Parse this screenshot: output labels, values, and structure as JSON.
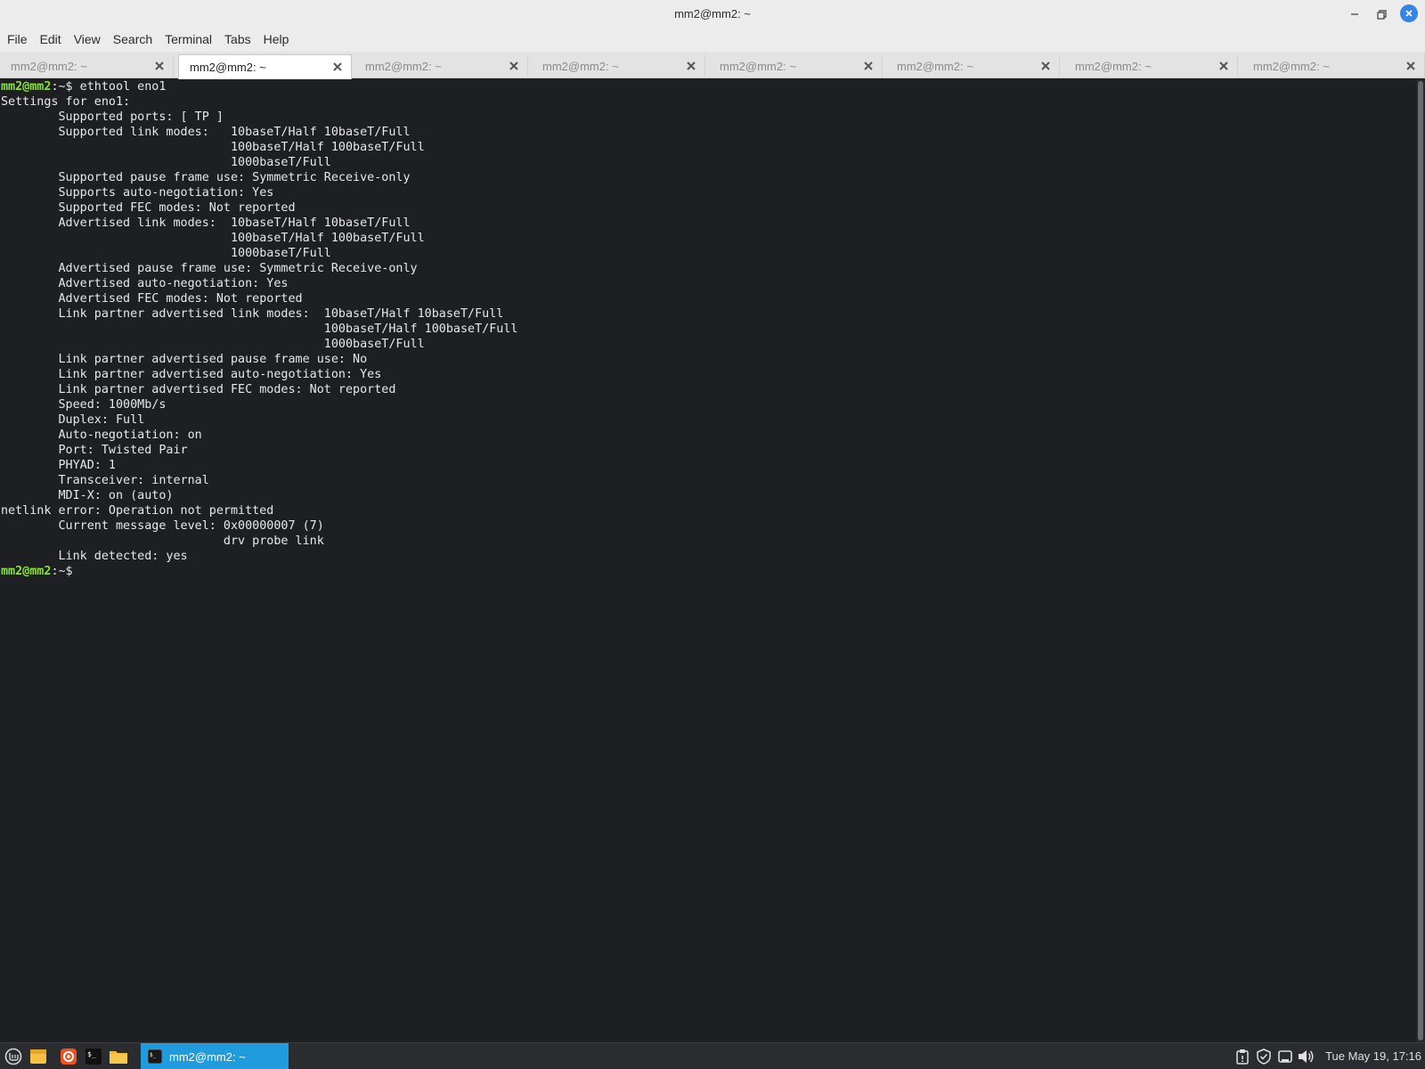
{
  "window": {
    "title": "mm2@mm2: ~"
  },
  "menu": [
    "File",
    "Edit",
    "View",
    "Search",
    "Terminal",
    "Tabs",
    "Help"
  ],
  "tabs": [
    {
      "label": "mm2@mm2: ~",
      "active": false
    },
    {
      "label": "mm2@mm2: ~",
      "active": true
    },
    {
      "label": "mm2@mm2: ~",
      "active": false
    },
    {
      "label": "mm2@mm2: ~",
      "active": false
    },
    {
      "label": "mm2@mm2: ~",
      "active": false
    },
    {
      "label": "mm2@mm2: ~",
      "active": false
    },
    {
      "label": "mm2@mm2: ~",
      "active": false
    },
    {
      "label": "mm2@mm2: ~",
      "active": false
    }
  ],
  "terminal": {
    "prompt_user": "mm2@mm2",
    "prompt_path": ":~$",
    "command": " ethtool eno1",
    "output": "Settings for eno1:\n        Supported ports: [ TP ]\n        Supported link modes:   10baseT/Half 10baseT/Full\n                                100baseT/Half 100baseT/Full\n                                1000baseT/Full\n        Supported pause frame use: Symmetric Receive-only\n        Supports auto-negotiation: Yes\n        Supported FEC modes: Not reported\n        Advertised link modes:  10baseT/Half 10baseT/Full\n                                100baseT/Half 100baseT/Full\n                                1000baseT/Full\n        Advertised pause frame use: Symmetric Receive-only\n        Advertised auto-negotiation: Yes\n        Advertised FEC modes: Not reported\n        Link partner advertised link modes:  10baseT/Half 10baseT/Full\n                                             100baseT/Half 100baseT/Full\n                                             1000baseT/Full\n        Link partner advertised pause frame use: No\n        Link partner advertised auto-negotiation: Yes\n        Link partner advertised FEC modes: Not reported\n        Speed: 1000Mb/s\n        Duplex: Full\n        Auto-negotiation: on\n        Port: Twisted Pair\n        PHYAD: 1\n        Transceiver: internal\n        MDI-X: on (auto)\nnetlink error: Operation not permitted\n        Current message level: 0x00000007 (7)\n                               drv probe link\n        Link detected: yes",
    "final_prompt_user": "mm2@mm2",
    "final_prompt_path": ":~$"
  },
  "taskbar": {
    "window_label": "mm2@mm2: ~",
    "clock": "Tue May 19, 17:16",
    "icons": [
      "mint-menu-icon",
      "files-icon",
      "browser-icon",
      "terminal-icon",
      "folder-icon"
    ],
    "tray": [
      "clipboard-icon",
      "shield-icon",
      "network-icon",
      "volume-icon"
    ]
  },
  "colors": {
    "terminal_bg": "#1e1f23",
    "prompt": "#8ae234",
    "accent": "#1f9bde"
  }
}
